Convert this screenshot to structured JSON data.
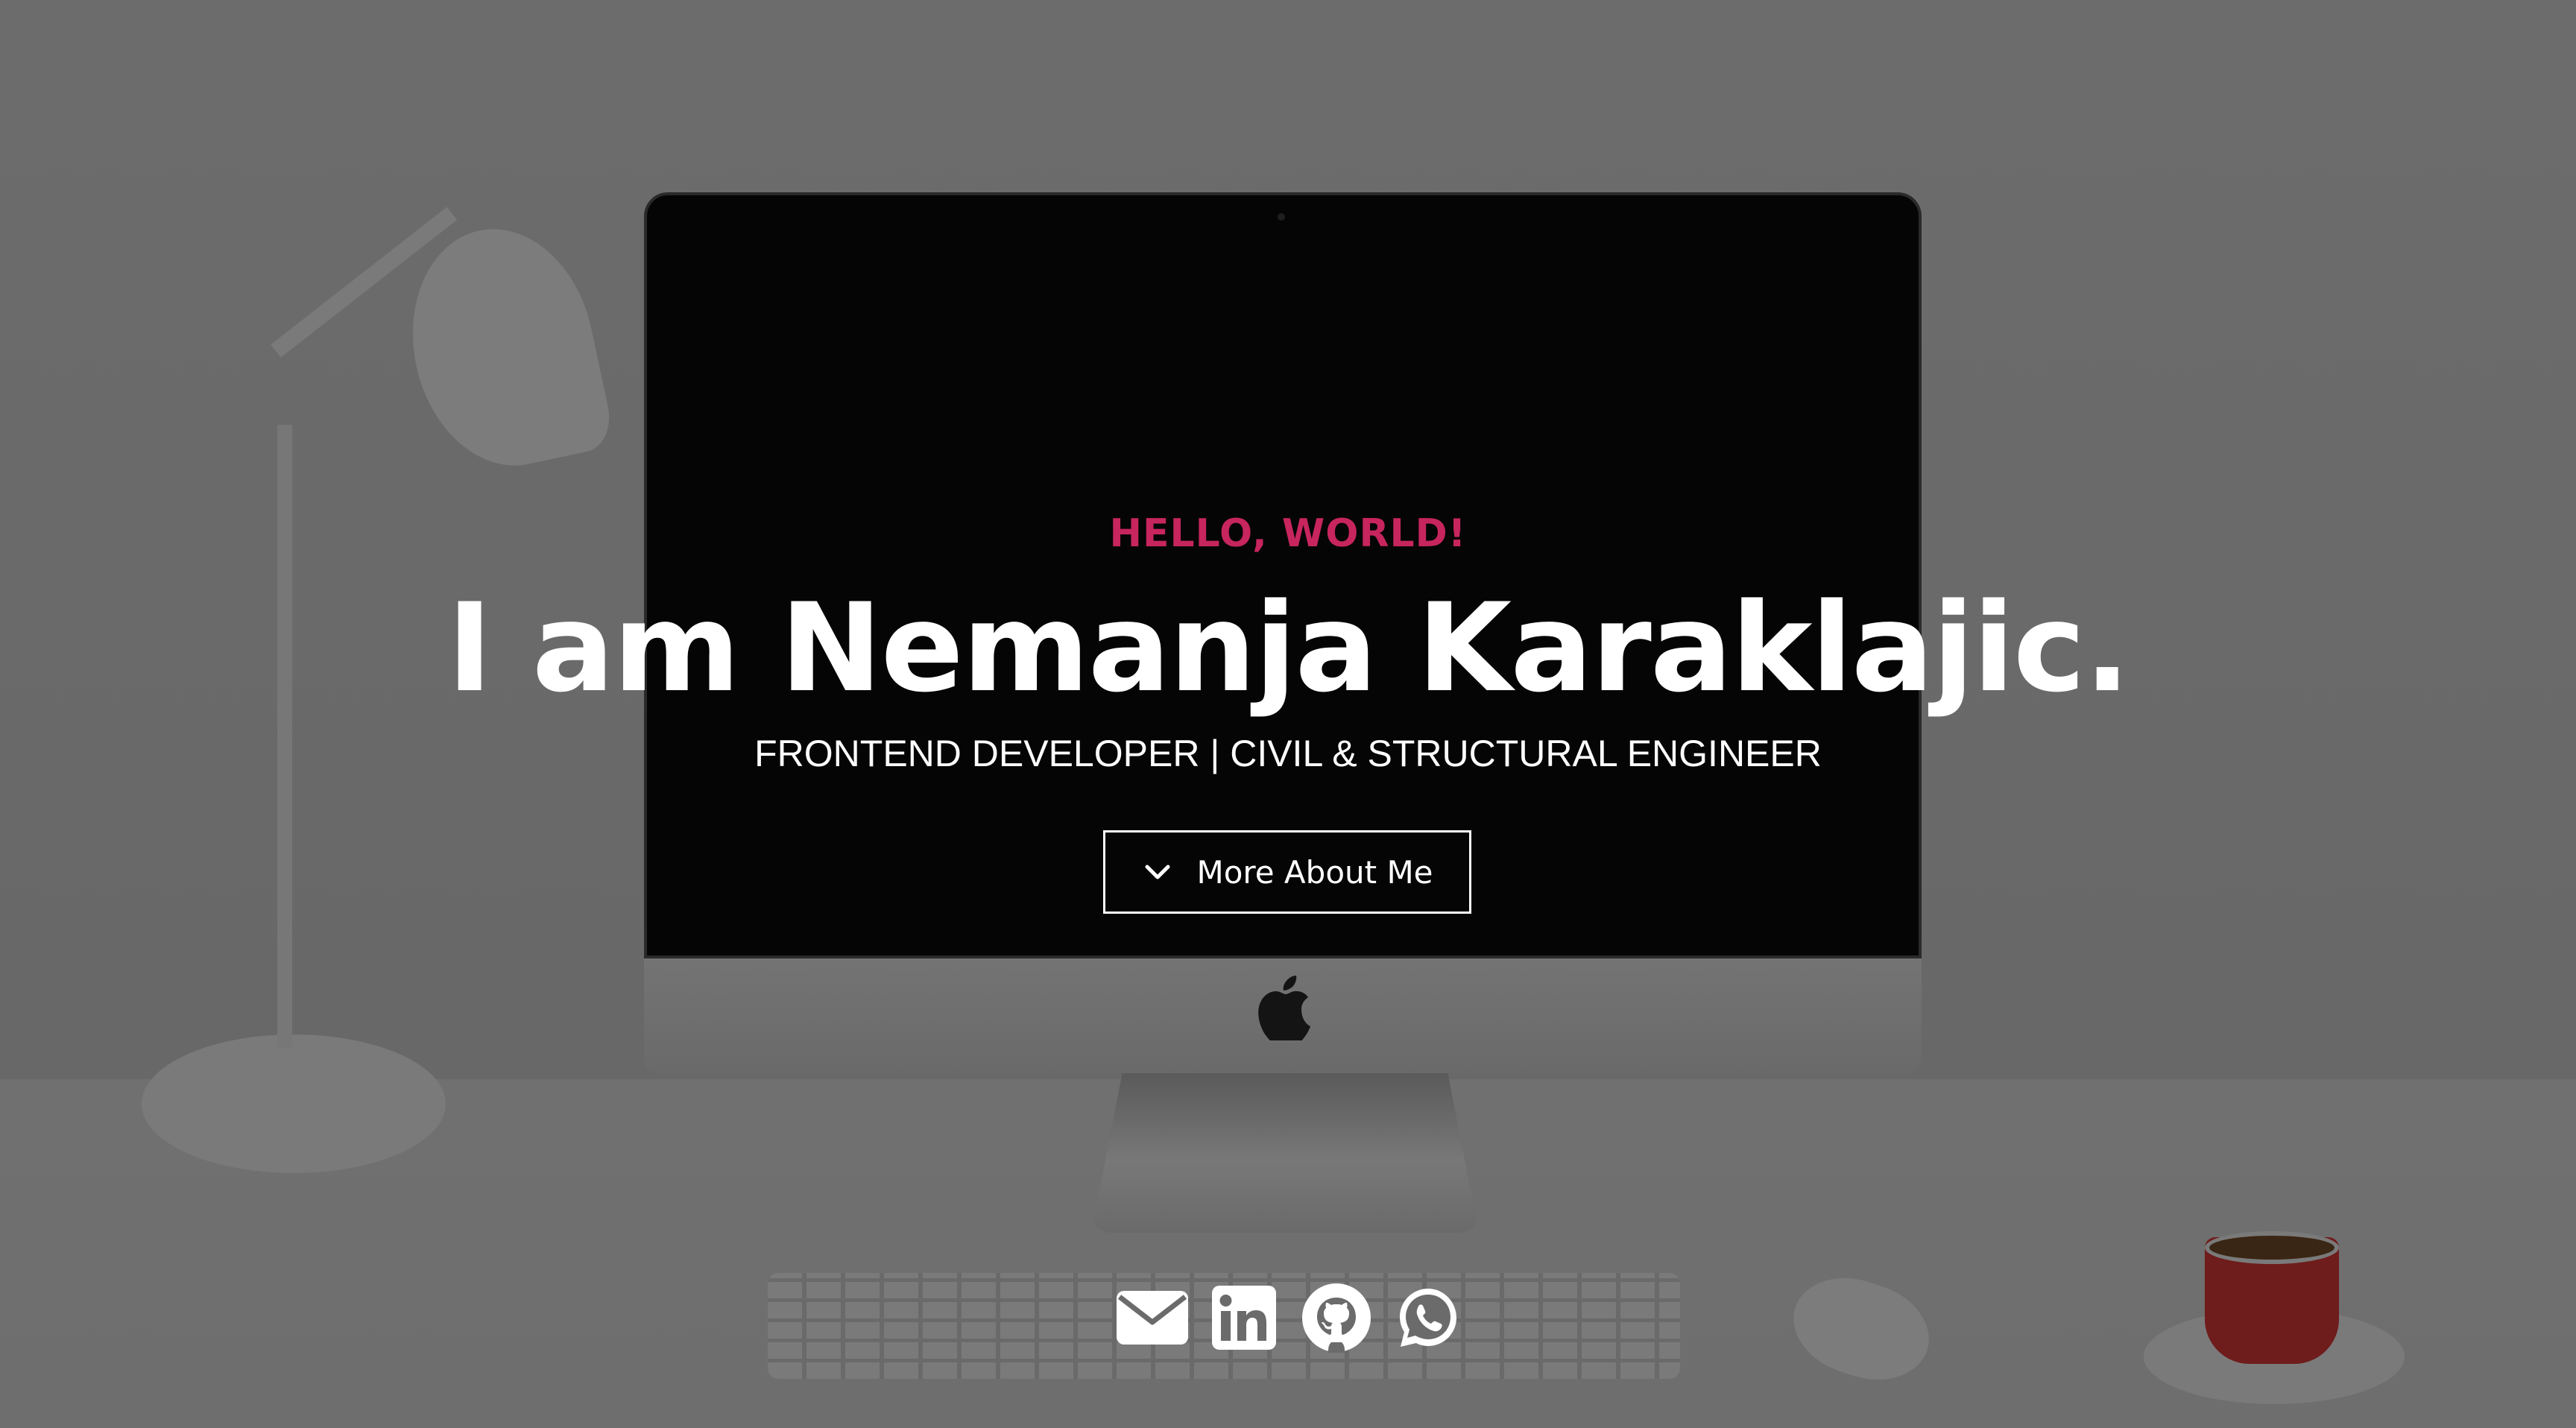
{
  "hero": {
    "greeting": "HELLO, WORLD!",
    "title": "I am Nemanja Karaklajic.",
    "subtitle": "FRONTEND DEVELOPER | CIVIL & STRUCTURAL ENGINEER",
    "more_button": {
      "label": "More About Me",
      "icon": "chevron-down-icon"
    }
  },
  "social_links": [
    {
      "icon": "envelope-icon",
      "service": "Email"
    },
    {
      "icon": "linkedin-icon",
      "service": "LinkedIn"
    },
    {
      "icon": "github-icon",
      "service": "GitHub"
    },
    {
      "icon": "whatsapp-icon",
      "service": "WhatsApp"
    }
  ],
  "colors": {
    "accent": "#c7255e",
    "text": "#ffffff",
    "overlay": "#6b6b6b"
  }
}
